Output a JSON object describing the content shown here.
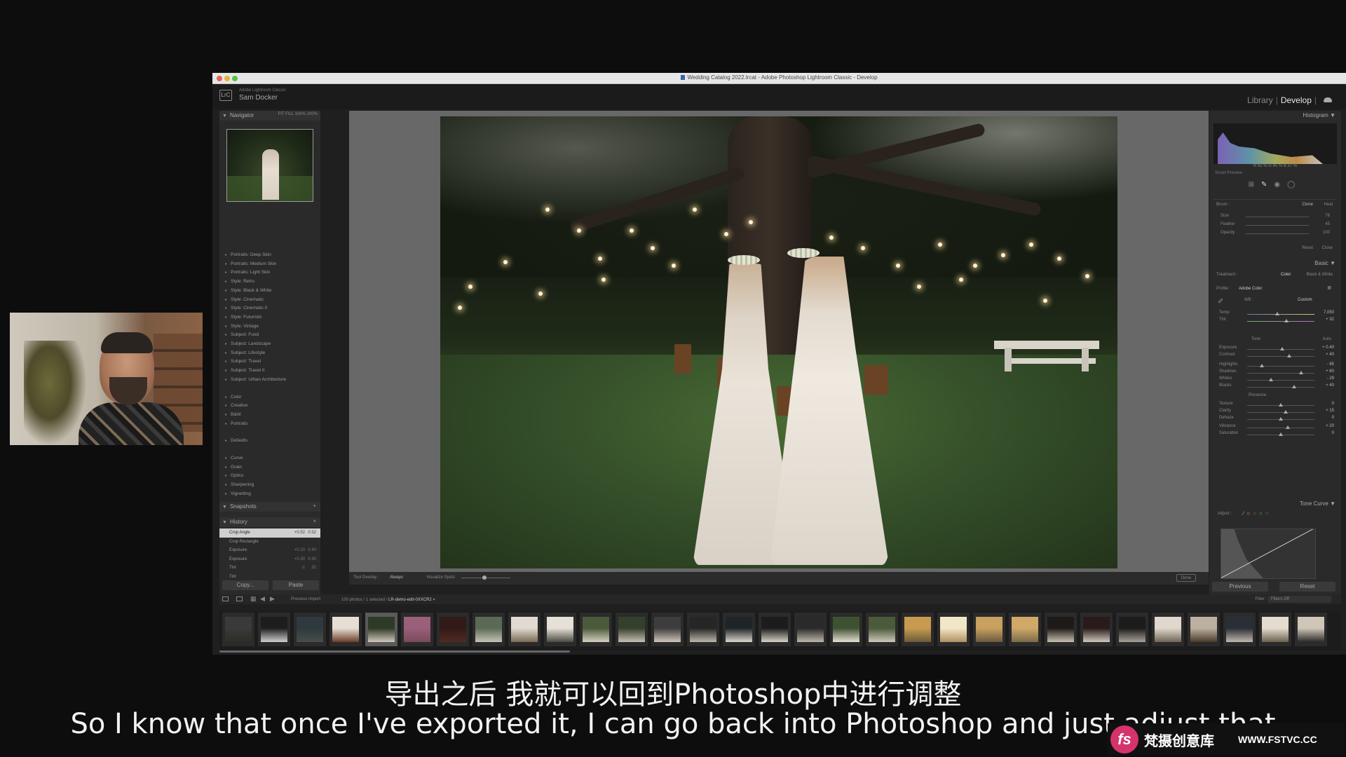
{
  "window": {
    "title": "Wedding Catalog 2022.lrcat - Adobe Photoshop Lightroom Classic - Develop",
    "app_sub": "Adobe Lightroom Classic",
    "user": "Sam Docker",
    "badge": "LrC",
    "modules": [
      "Library",
      "Develop"
    ],
    "active_module": "Develop"
  },
  "navigator": {
    "title": "Navigator",
    "zoom_options": "FIT  FILL  100%  200%"
  },
  "presets": {
    "groups1": [
      "Portraits: Deep Skin",
      "Portraits: Medium Skin",
      "Portraits: Light Skin",
      "Style: Retro",
      "Style: Black & White",
      "Style: Cinematic",
      "Style: Cinematic II",
      "Style: Futuristic",
      "Style: Vintage",
      "Subject: Food",
      "Subject: Landscape",
      "Subject: Lifestyle",
      "Subject: Travel",
      "Subject: Travel II",
      "Subject: Urban Architecture"
    ],
    "groups2": [
      "Color",
      "Creative",
      "B&W",
      "Portraits"
    ],
    "groups3": [
      "Defaults"
    ],
    "groups4": [
      "Curve",
      "Grain",
      "Optics",
      "Sharpening",
      "Vignetting"
    ]
  },
  "snapshots": {
    "title": "Snapshots"
  },
  "history": {
    "title": "History",
    "items": [
      {
        "label": "Crop Angle",
        "v1": "+0.52",
        "v2": "0.52",
        "selected": true
      },
      {
        "label": "Crop Rectangle",
        "v1": "",
        "v2": "",
        "selected": false
      },
      {
        "label": "Exposure",
        "v1": "+0.10",
        "v2": "0.40",
        "selected": false
      },
      {
        "label": "Exposure",
        "v1": "+0.30",
        "v2": "0.30",
        "selected": false
      },
      {
        "label": "Tint",
        "v1": "-1",
        "v2": "32",
        "selected": false
      },
      {
        "label": "Tint",
        "v1": "",
        "v2": "",
        "selected": false
      }
    ]
  },
  "left_buttons": {
    "copy": "Copy...",
    "paste": "Paste"
  },
  "toolbar": {
    "tool_overlay_label": "Tool Overlay :",
    "tool_overlay_value": "Always",
    "visualize_spots": "Visualize Spots",
    "done": "Done"
  },
  "right": {
    "histogram_title": "Histogram",
    "histo_values": "R  62 %   G  45 %   B  37 %",
    "smart_preview": "Smart Preview",
    "brush": {
      "title": "Brush :",
      "clone": "Clone",
      "heal": "Heal",
      "rows": [
        {
          "label": "Size",
          "value": "76"
        },
        {
          "label": "Feather",
          "value": "45"
        },
        {
          "label": "Opacity",
          "value": "100"
        }
      ],
      "reset": "Reset",
      "close": "Close"
    },
    "basic": {
      "title": "Basic",
      "treatment": "Treatment :",
      "color": "Color",
      "bw": "Black & White",
      "profile_label": "Profile :",
      "profile_value": "Adobe Color",
      "wb_label": "WB :",
      "wb_value": "Custom",
      "tone_label": "Tone",
      "auto": "Auto",
      "presence_label": "Presence",
      "sliders": [
        {
          "label": "Temp",
          "value": "7,050",
          "pos": 0.45,
          "kind": "temp"
        },
        {
          "label": "Tint",
          "value": "+ 32",
          "pos": 0.58,
          "kind": "tint"
        },
        {
          "label": "Exposure",
          "value": "+ 0.40",
          "pos": 0.52,
          "kind": ""
        },
        {
          "label": "Contrast",
          "value": "+ 40",
          "pos": 0.62,
          "kind": ""
        },
        {
          "label": "Highlights",
          "value": "- 65",
          "pos": 0.22,
          "kind": ""
        },
        {
          "label": "Shadows",
          "value": "+ 60",
          "pos": 0.8,
          "kind": ""
        },
        {
          "label": "Whites",
          "value": "- 29",
          "pos": 0.35,
          "kind": ""
        },
        {
          "label": "Blacks",
          "value": "+ 40",
          "pos": 0.7,
          "kind": ""
        },
        {
          "label": "Texture",
          "value": "0",
          "pos": 0.5,
          "kind": ""
        },
        {
          "label": "Clarity",
          "value": "+ 15",
          "pos": 0.57,
          "kind": ""
        },
        {
          "label": "Dehaze",
          "value": "0",
          "pos": 0.5,
          "kind": ""
        },
        {
          "label": "Vibrance",
          "value": "+ 20",
          "pos": 0.6,
          "kind": ""
        },
        {
          "label": "Saturation",
          "value": "0",
          "pos": 0.5,
          "kind": ""
        }
      ]
    },
    "tone_curve_title": "Tone Curve",
    "adjust_label": "Adjust :",
    "previous": "Previous",
    "reset": "Reset"
  },
  "filmstrip": {
    "source": "Previous Import",
    "count": "100 photos / 1 selected /",
    "filename": "LR-demo-edit-0XXCR2",
    "filter_label": "Filter :",
    "filter_value": "Filters Off",
    "thumbs": [
      {
        "c1": "#3a3a3a",
        "c2": "#2a2f26"
      },
      {
        "c1": "#1d1d1d",
        "c2": "#cfcfcf"
      },
      {
        "c1": "#2e3a3d",
        "c2": "#474d4a"
      },
      {
        "c1": "#e8dfd4",
        "c2": "#6b3d2a"
      },
      {
        "c1": "#2f3a26",
        "c2": "#d0c8bd"
      },
      {
        "c1": "#9a5f7a",
        "c2": "#7a4a5a"
      },
      {
        "c1": "#311a18",
        "c2": "#522a22"
      },
      {
        "c1": "#5a6a55",
        "c2": "#c8c2b5"
      },
      {
        "c1": "#e0dad0",
        "c2": "#7a6a54"
      },
      {
        "c1": "#e6e0d6",
        "c2": "#4a4a42"
      },
      {
        "c1": "#4b5a3a",
        "c2": "#d8d0c2"
      },
      {
        "c1": "#34402c",
        "c2": "#c8c0b0"
      },
      {
        "c1": "#3d3d3d",
        "c2": "#cfc6b8"
      },
      {
        "c1": "#262626",
        "c2": "#bdb6aa"
      },
      {
        "c1": "#1f2428",
        "c2": "#dcd6cc"
      },
      {
        "c1": "#1c1c1c",
        "c2": "#d8d2c8"
      },
      {
        "c1": "#2a2a2a",
        "c2": "#bfb7aa"
      },
      {
        "c1": "#3e5232",
        "c2": "#e6e0d4"
      },
      {
        "c1": "#4a5a3a",
        "c2": "#d0c8ba"
      },
      {
        "c1": "#c89a50",
        "c2": "#6a5a3a"
      },
      {
        "c1": "#f2e6c8",
        "c2": "#b09060"
      },
      {
        "c1": "#c8a060",
        "c2": "#6a5a3e"
      },
      {
        "c1": "#d0a868",
        "c2": "#7a6a4a"
      },
      {
        "c1": "#1e1a18",
        "c2": "#c8c0b0"
      },
      {
        "c1": "#2a1a1a",
        "c2": "#cfc8bc"
      },
      {
        "c1": "#1c1c1c",
        "c2": "#a8a098"
      },
      {
        "c1": "#e0d8cc",
        "c2": "#706456"
      },
      {
        "c1": "#bcb0a0",
        "c2": "#4a3a2a"
      },
      {
        "c1": "#2a2e36",
        "c2": "#c0b8ae"
      },
      {
        "c1": "#e4dccf",
        "c2": "#6a604e"
      },
      {
        "c1": "#cfc6b8",
        "c2": "#2a2a28"
      }
    ]
  },
  "subtitles": {
    "cn": "导出之后 我就可以回到Photoshop中进行调整",
    "en": "So I know that once I've exported it, I can go back into Photoshop and just adjust that"
  },
  "watermark": {
    "logo": "fs",
    "cn": "梵摄创意库",
    "url": "WWW.FSTVC.CC"
  }
}
